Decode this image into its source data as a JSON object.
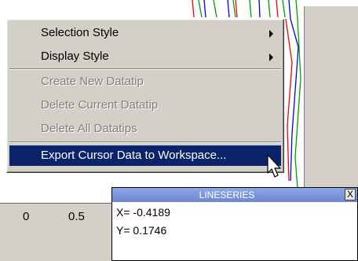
{
  "context_menu": {
    "items": [
      {
        "label": "Selection Style",
        "disabled": false,
        "submenu": true,
        "highlighted": false
      },
      {
        "label": "Display Style",
        "disabled": false,
        "submenu": true,
        "highlighted": false
      },
      {
        "label": "Create New Datatip",
        "disabled": true,
        "submenu": false,
        "highlighted": false
      },
      {
        "label": "Delete Current Datatip",
        "disabled": true,
        "submenu": false,
        "highlighted": false
      },
      {
        "label": "Delete All Datatips",
        "disabled": true,
        "submenu": false,
        "highlighted": false
      },
      {
        "label": "Export Cursor Data to Workspace...",
        "disabled": false,
        "submenu": false,
        "highlighted": true
      }
    ]
  },
  "axis": {
    "tick_labels": [
      "0",
      "0.5"
    ]
  },
  "datatip": {
    "title": "LINESERIES",
    "close_label": "X",
    "x_text": "X= -0.4189",
    "y_text": "Y= 0.1746"
  },
  "colors": {
    "menu_bg": "#d4d0c8",
    "highlight": "#0a246a",
    "datatip_title_bg": "#7a96df"
  }
}
